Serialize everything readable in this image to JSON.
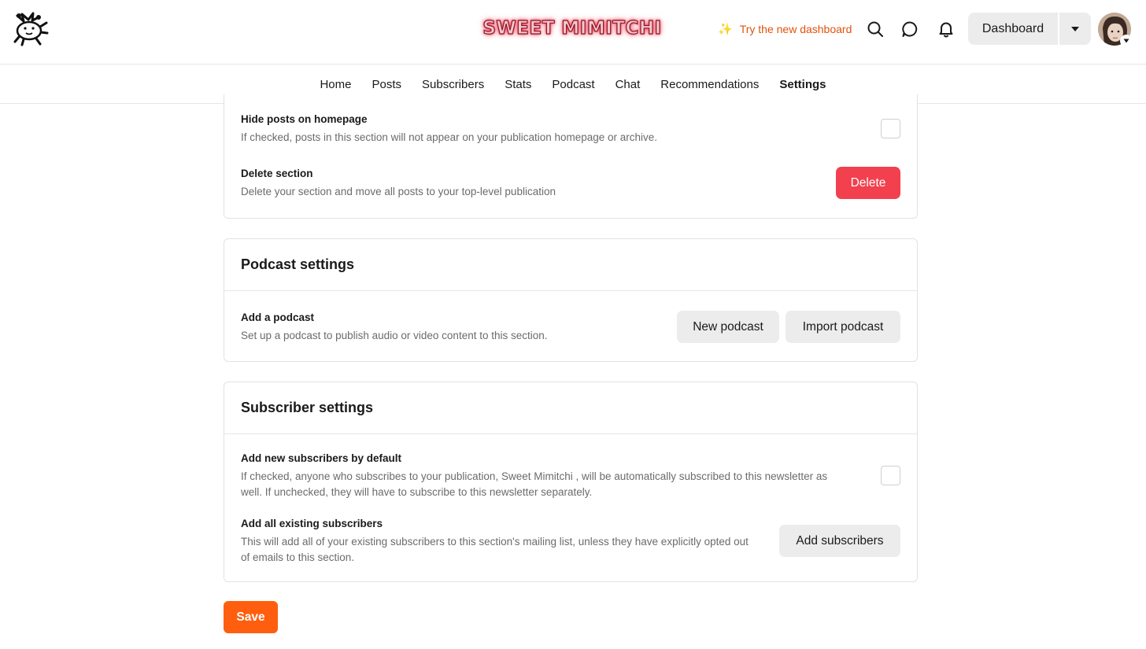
{
  "header": {
    "publication_name": "SWEET MIMITCHI",
    "try_dashboard": "Try the new dashboard",
    "dashboard_label": "Dashboard",
    "accent_color": "#e0520e"
  },
  "nav": {
    "tabs": [
      {
        "label": "Home"
      },
      {
        "label": "Posts"
      },
      {
        "label": "Subscribers"
      },
      {
        "label": "Stats"
      },
      {
        "label": "Podcast"
      },
      {
        "label": "Chat"
      },
      {
        "label": "Recommendations"
      },
      {
        "label": "Settings"
      }
    ],
    "active": "Settings"
  },
  "section_settings": {
    "hide_posts": {
      "title": "Hide posts on homepage",
      "description": "If checked, posts in this section will not appear on your publication homepage or archive.",
      "checked": false
    },
    "delete_section": {
      "title": "Delete section",
      "description": "Delete your section and move all posts to your top-level publication",
      "button": "Delete"
    }
  },
  "podcast_settings": {
    "heading": "Podcast settings",
    "add_podcast": {
      "title": "Add a podcast",
      "description": "Set up a podcast to publish audio or video content to this section.",
      "new_button": "New podcast",
      "import_button": "Import podcast"
    }
  },
  "subscriber_settings": {
    "heading": "Subscriber settings",
    "add_new_default": {
      "title": "Add new subscribers by default",
      "description": "If checked, anyone who subscribes to your publication, Sweet Mimitchi , will be automatically subscribed to this newsletter as well. If unchecked, they will have to subscribe to this newsletter separately.",
      "checked": false
    },
    "add_existing": {
      "title": "Add all existing subscribers",
      "description": "This will add all of your existing subscribers to this section's mailing list, unless they have explicitly opted out of emails to this section.",
      "button": "Add subscribers"
    }
  },
  "footer": {
    "save_label": "Save"
  },
  "icons": {
    "logo": "jester-mascot-logo",
    "search": "search-icon",
    "chat": "chat-bubble-icon",
    "notifications": "bell-icon",
    "dashboard_menu": "caret-down-icon",
    "spark": "sparkles-icon"
  }
}
